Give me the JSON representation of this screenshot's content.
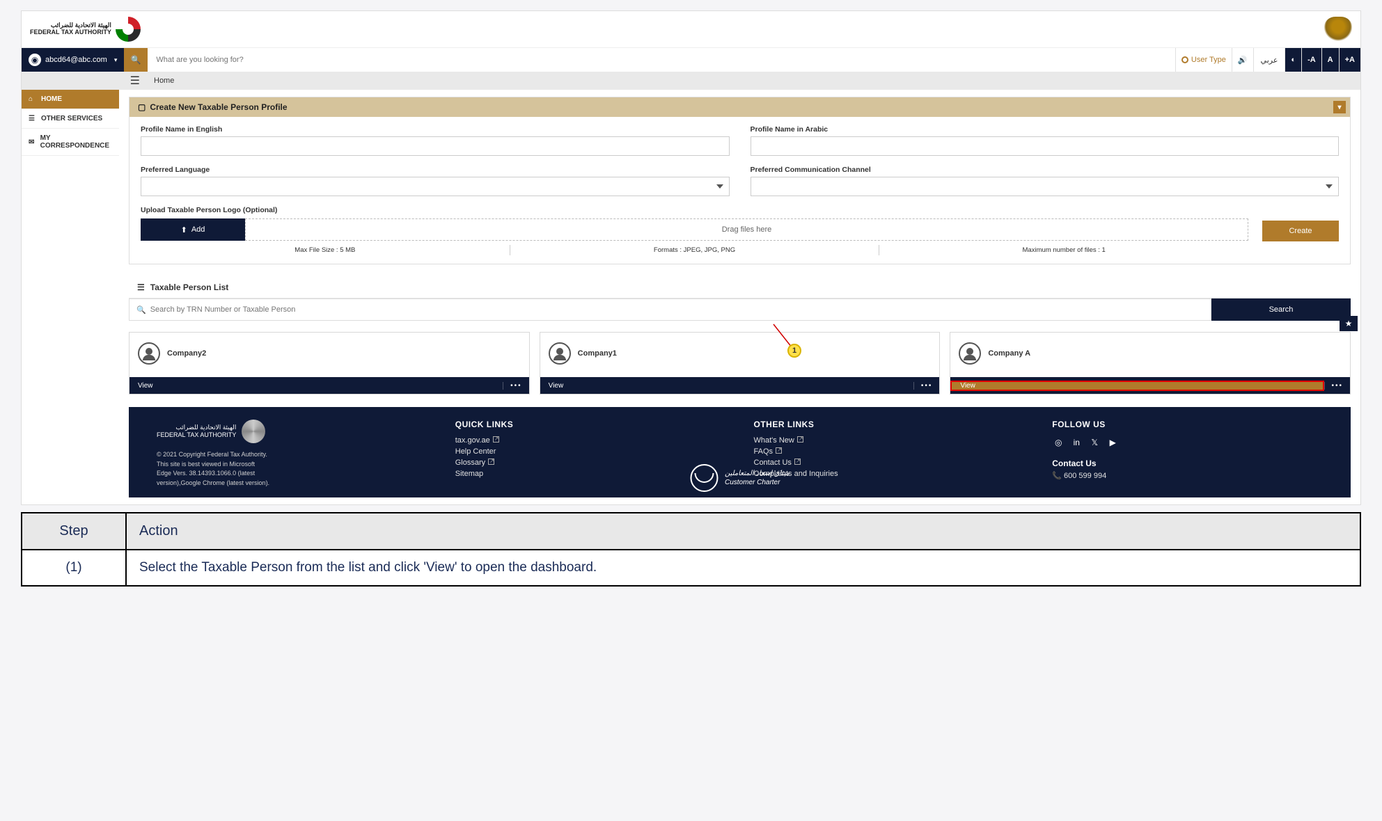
{
  "logo": {
    "line1_ar": "الهيئة الاتحادية للضرائب",
    "line2_en": "FEDERAL TAX AUTHORITY"
  },
  "topbar": {
    "user_email": "abcd64@abc.com",
    "search_placeholder": "What are you looking for?",
    "user_type_label": "User Type",
    "lang_ar": "عربي",
    "font_minus": "-A",
    "font_norm": "A",
    "font_plus": "+A"
  },
  "breadcrumb": {
    "home": "Home"
  },
  "sidebar": {
    "items": [
      {
        "label": "HOME"
      },
      {
        "label": "OTHER SERVICES"
      },
      {
        "label": "MY CORRESPONDENCE"
      }
    ]
  },
  "create_panel": {
    "title": "Create New Taxable Person Profile",
    "profile_name_en_label": "Profile Name in English",
    "profile_name_ar_label": "Profile Name in Arabic",
    "pref_lang_label": "Preferred Language",
    "pref_channel_label": "Preferred Communication Channel",
    "upload_label": "Upload Taxable Person Logo (Optional)",
    "add_btn": "Add",
    "drag_text": "Drag files here",
    "hint_size": "Max File Size : 5 MB",
    "hint_formats": "Formats : JPEG, JPG, PNG",
    "hint_max": "Maximum number of files : 1",
    "create_btn": "Create"
  },
  "list_panel": {
    "title": "Taxable Person List",
    "search_placeholder": "Search by TRN Number or Taxable Person",
    "search_btn": "Search",
    "cards": [
      {
        "name": "Company2",
        "view": "View"
      },
      {
        "name": "Company1",
        "view": "View"
      },
      {
        "name": "Company A",
        "view": "View"
      }
    ]
  },
  "footer": {
    "copy1": "© 2021 Copyright Federal Tax Authority.",
    "copy2": "This site is best viewed in Microsoft",
    "copy3": "Edge Vers. 38.14393.1066.0 (latest",
    "copy4": "version),Google Chrome (latest version).",
    "quick_h": "QUICK LINKS",
    "quick": [
      "tax.gov.ae",
      "Help Center",
      "Glossary",
      "Sitemap"
    ],
    "other_h": "OTHER LINKS",
    "other": [
      "What's New",
      "FAQs",
      "Contact Us",
      "Complaints and Inquiries"
    ],
    "follow_h": "FOLLOW US",
    "contact_h": "Contact Us",
    "phone": "600 599 994",
    "charter_ar": "ميثاق إسعاد المتعاملين",
    "charter_en": "Customer Charter"
  },
  "callout": {
    "num": "1"
  },
  "step_table": {
    "h1": "Step",
    "h2": "Action",
    "r1_step": "(1)",
    "r1_action": "Select the Taxable Person from the list and click 'View' to open the dashboard."
  }
}
